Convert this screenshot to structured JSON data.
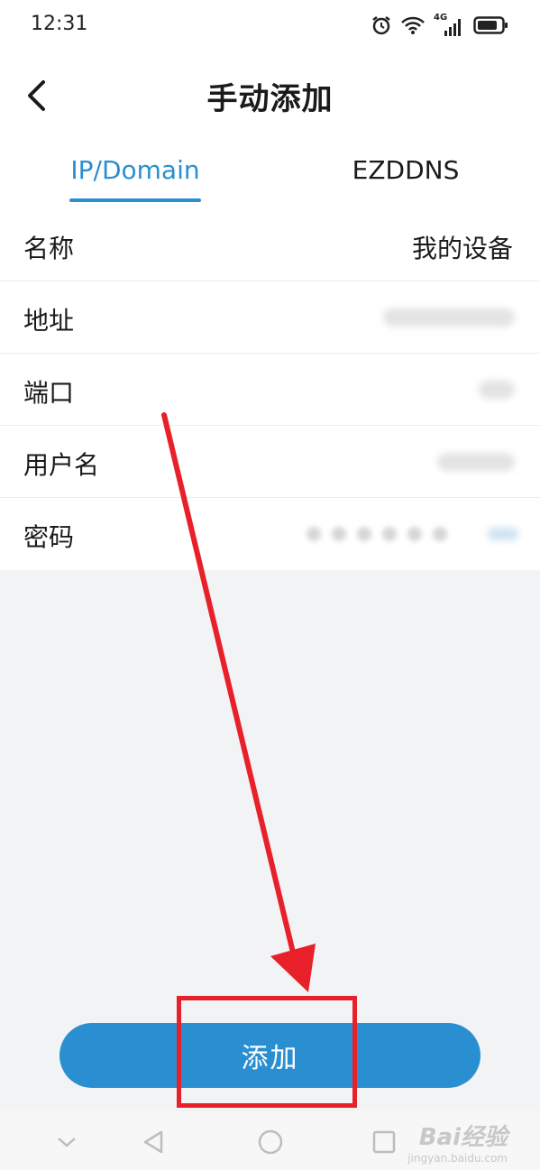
{
  "status_bar": {
    "time": "12:31",
    "network": "4G"
  },
  "header": {
    "title": "手动添加"
  },
  "tabs": [
    {
      "label": "IP/Domain",
      "active": true
    },
    {
      "label": "EZDDNS",
      "active": false
    }
  ],
  "form": {
    "rows": [
      {
        "label": "名称",
        "value": "我的设备"
      },
      {
        "label": "地址",
        "value": ""
      },
      {
        "label": "端口",
        "value": ""
      },
      {
        "label": "用户名",
        "value": ""
      },
      {
        "label": "密码",
        "value": ""
      }
    ]
  },
  "add_button": {
    "label": "添加"
  },
  "watermark": {
    "logo": "Bai经验",
    "url": "jingyan.baidu.com"
  },
  "colors": {
    "accent": "#2a8fd0",
    "annotation": "#e8202a",
    "background": "#f2f3f5"
  }
}
